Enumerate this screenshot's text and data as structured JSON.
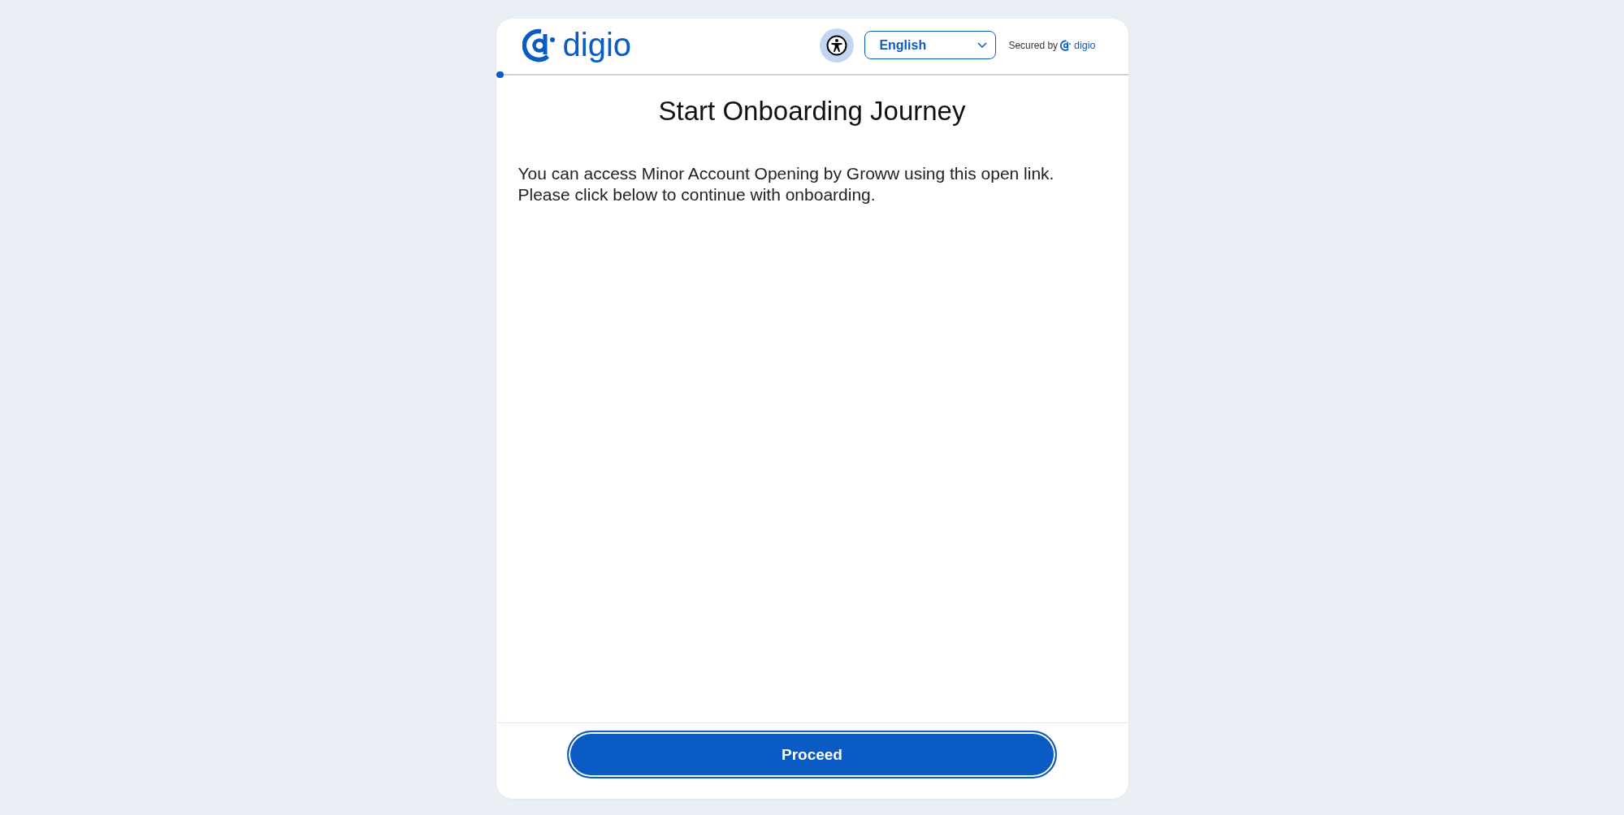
{
  "header": {
    "logo": {
      "text": "digio"
    },
    "language_select": {
      "value": "English"
    },
    "secured_by": {
      "label": "Secured by",
      "logo_text": "digio"
    }
  },
  "progress": {
    "level": 0.012
  },
  "title": "Start Onboarding Journey",
  "message": "You can access Minor Account Opening by Groww using this open link.\nPlease click below to continue with onboarding.",
  "footer": {
    "button": {
      "label": "Proceed"
    }
  }
}
